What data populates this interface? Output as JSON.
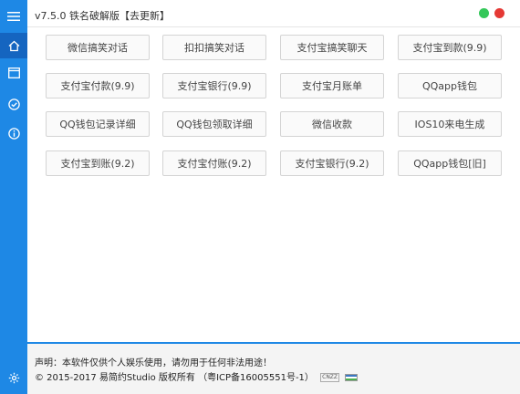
{
  "app": {
    "title": "v7.5.0 铁名破解版【去更新】"
  },
  "sidebar": {
    "icons": [
      "menu-icon",
      "home-icon",
      "window-icon",
      "check-circle-icon",
      "info-icon",
      "settings-icon"
    ]
  },
  "buttons": [
    {
      "label": "微信搞笑对话"
    },
    {
      "label": "扣扣搞笑对话"
    },
    {
      "label": "支付宝搞笑聊天"
    },
    {
      "label": "支付宝到款(9.9)"
    },
    {
      "label": "支付宝付款(9.9)"
    },
    {
      "label": "支付宝银行(9.9)"
    },
    {
      "label": "支付宝月账单"
    },
    {
      "label": "QQapp钱包"
    },
    {
      "label": "QQ钱包记录详细"
    },
    {
      "label": "QQ钱包领取详细"
    },
    {
      "label": "微信收款"
    },
    {
      "label": "IOS10来电生成"
    },
    {
      "label": "支付宝到账(9.2)"
    },
    {
      "label": "支付宝付账(9.2)"
    },
    {
      "label": "支付宝银行(9.2)"
    },
    {
      "label": "QQapp钱包[旧]"
    }
  ],
  "footer": {
    "notice": "声明：本软件仅供个人娱乐使用，请勿用于任何非法用途！",
    "copyright": "© 2015-2017 易简约Studio 版权所有",
    "icp": "（粤ICP备16005551号-1）",
    "badge": "CNZZ"
  },
  "colors": {
    "accent": "#1e88e5",
    "accent_dark": "#1565c0",
    "green": "#34c759",
    "red": "#e53935"
  }
}
